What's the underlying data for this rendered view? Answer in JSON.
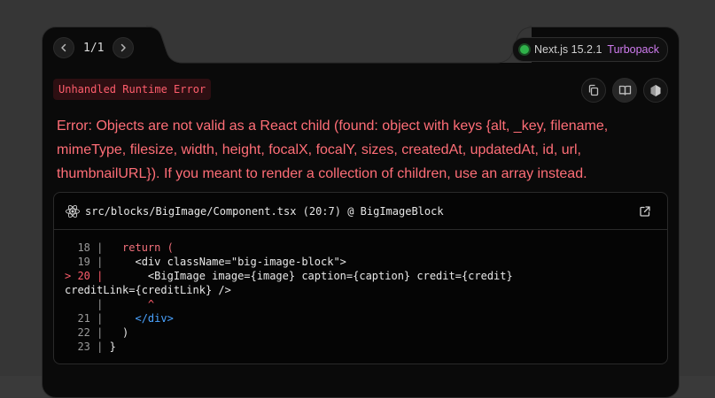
{
  "pager": {
    "count": "1/1",
    "prev_icon": "chevron-left-icon",
    "next_icon": "chevron-right-icon"
  },
  "version": {
    "label": "Next.js 15.2.1",
    "bundler": "Turbopack",
    "status_color": "#2fb24a"
  },
  "error": {
    "badge": "Unhandled Runtime Error",
    "message": "Error: Objects are not valid as a React child (found: object with keys {alt, _key, filename, mimeType, filesize, width, height, focalX, focalY, sizes, createdAt, updatedAt, id, url, thumbnailURL}). If you meant to render a collection of children, use an array instead."
  },
  "actions": [
    {
      "name": "copy-icon"
    },
    {
      "name": "docs-book-icon"
    },
    {
      "name": "nodejs-icon"
    }
  ],
  "code_frame": {
    "file": "src/blocks/BigImage/Component.tsx (20:7) @ BigImageBlock",
    "lines": [
      {
        "gutter": "  18 |",
        "code": "   return ("
      },
      {
        "gutter": "  19 |",
        "code": "     <div className=\"big-image-block\">"
      },
      {
        "gutter": "> 20 |",
        "code": "       <BigImage image={image} caption={caption} credit={credit}"
      },
      {
        "gutter": "",
        "code": "creditLink={creditLink} />"
      },
      {
        "gutter": "     |",
        "code": "       ^"
      },
      {
        "gutter": "  21 |",
        "code": "     </div>"
      },
      {
        "gutter": "  22 |",
        "code": "   )"
      },
      {
        "gutter": "  23 |",
        "code": " }"
      }
    ]
  },
  "colors": {
    "accent_error": "#ff6e77",
    "turbopack": "#d07cf0"
  }
}
